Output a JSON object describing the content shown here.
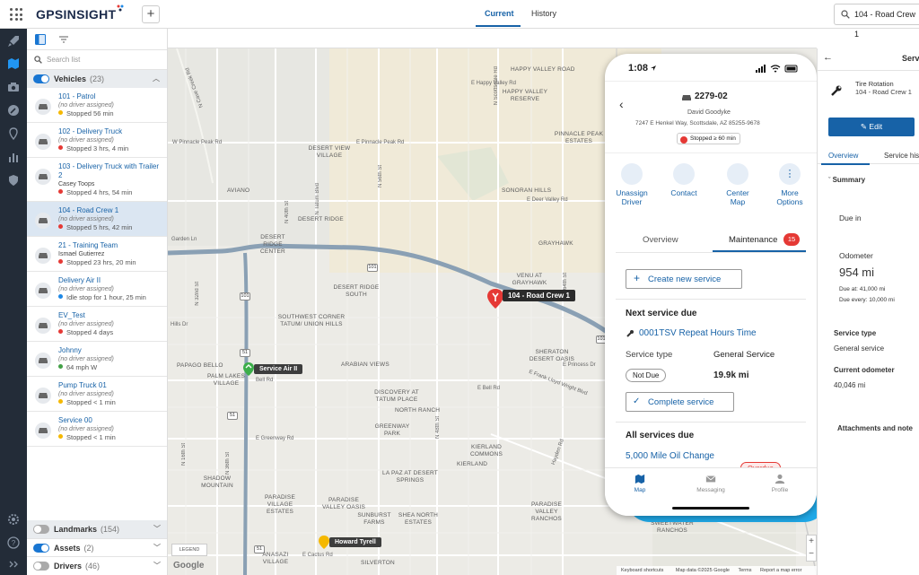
{
  "app": {
    "logo_text": "GPSINSIGHT",
    "tabs": [
      {
        "label": "Current"
      },
      {
        "label": "History"
      }
    ],
    "search_value": "104 - Road Crew 1"
  },
  "panel": {
    "search_placeholder": "Search list",
    "vehicles_header": {
      "label": "Vehicles",
      "count": "(23)"
    },
    "vehicles": [
      {
        "name": "101 - Patrol",
        "driver": "(no driver assigned)",
        "status": "Stopped 56 min",
        "dot": "yellow"
      },
      {
        "name": "102 - Delivery Truck",
        "driver": "(no driver assigned)",
        "status": "Stopped 3 hrs, 4 min",
        "dot": "red"
      },
      {
        "name": "103 - Delivery Truck with Trailer 2",
        "driver": "Casey Toops",
        "status": "Stopped 4 hrs, 54 min",
        "dot": "red"
      },
      {
        "name": "104 - Road Crew 1",
        "driver": "(no driver assigned)",
        "status": "Stopped 5 hrs, 42 min",
        "dot": "red"
      },
      {
        "name": "21 - Training Team",
        "driver": "Ismael Gutierrez",
        "status": "Stopped 23 hrs, 20 min",
        "dot": "red"
      },
      {
        "name": "Delivery Air II",
        "driver": "(no driver assigned)",
        "status": "Idle stop for 1 hour, 25 min",
        "dot": "blue"
      },
      {
        "name": "EV_Test",
        "driver": "(no driver assigned)",
        "status": "Stopped 4 days",
        "dot": "red"
      },
      {
        "name": "Johnny",
        "driver": "(no driver assigned)",
        "status": "64 mph W",
        "dot": "green"
      },
      {
        "name": "Pump Truck 01",
        "driver": "(no driver assigned)",
        "status": "Stopped < 1 min",
        "dot": "yellow"
      },
      {
        "name": "Service 00",
        "driver": "(no driver assigned)",
        "status": "Stopped < 1 min",
        "dot": "yellow"
      }
    ],
    "landmarks_header": {
      "label": "Landmarks",
      "count": "(154)"
    },
    "assets_header": {
      "label": "Assets",
      "count": "(2)"
    },
    "drivers_header": {
      "label": "Drivers",
      "count": "(46)"
    }
  },
  "map": {
    "areas": [
      "HAPPY VALLEY ROAD",
      "HAPPY VALLEY RESERVE",
      "PINNACLE PEAK ESTATES",
      "DESERT VIEW VILLAGE",
      "AVIANO",
      "SONORAN HILLS",
      "DESERT RIDGE",
      "GRAYHAWK",
      "DESERT RIDGE CENTER",
      "VENU AT GRAYHAWK",
      "DESERT RIDGE SOUTH",
      "SOUTHWEST CORNER TATUM/ UNION HILLS",
      "PAPAGO BELLO",
      "ARABIAN VIEWS",
      "SHERATON DESERT OASIS",
      "PALM LAKES VILLAGE",
      "DISCOVERY AT TATUM PLACE",
      "NORTH RANCH",
      "GREENWAY PARK",
      "KIERLAND COMMONS",
      "KIERLAND",
      "LA PAZ AT DESERT SPRINGS",
      "SHADOW MOUNTAIN",
      "PARADISE VILLAGE ESTATES",
      "PARADISE VALLEY OASIS",
      "SUNBURST FARMS",
      "SHEA NORTH ESTATES",
      "ANASAZI VILLAGE",
      "PARADISE VALLEY RANCHOS",
      "SWEETWATER RANCHOS",
      "SILVERTON"
    ],
    "roads": [
      "W Pinnacle Peak Rd",
      "E Pinnacle Peak Rd",
      "E Happy Valley Rd",
      "E Deer Valley Rd",
      "Bell Rd",
      "E Greenway Rd",
      "E Frank Lloyd Wright Blvd",
      "E Princess Dr",
      "E Cactus Rd",
      "N Scottsdale Rd",
      "N Tatum Blvd",
      "N 56th St",
      "N 40th St",
      "N 32nd St",
      "N Cave Creek Rd",
      "Garden Ln",
      "Hills Dr",
      "E Bell Rd",
      "Hayden Rd",
      "N 16th St",
      "N 36th St",
      "N 48th St",
      "N 64th St"
    ],
    "highway_shields": [
      "101",
      "101",
      "51",
      "101",
      "51",
      "51"
    ],
    "pins": [
      {
        "label": "104 - Road Crew 1",
        "color": "#e53935"
      },
      {
        "label": "Service Air II",
        "color": "#3cae4a"
      },
      {
        "label": "Howard Tyrell",
        "color": "#f5b800"
      }
    ],
    "legend": "LEGEND",
    "attribution": [
      "Keyboard shortcuts",
      "Map data ©2025 Google",
      "Terms",
      "Report a map error"
    ],
    "google": "Google"
  },
  "phone": {
    "time": "1:08",
    "vehicle_id": "2279-02",
    "driver": "David Goodyke",
    "address": "7247 E Henkel Way, Scottsdale, AZ 85255-9678",
    "status_badge": "Stopped ≥ 60 min",
    "actions": [
      {
        "label": "Unassign Driver",
        "icon": "unassign-driver-icon"
      },
      {
        "label": "Contact",
        "icon": "contact-card-icon"
      },
      {
        "label": "Center Map",
        "icon": "center-map-icon"
      },
      {
        "label": "More Options",
        "icon": "more-options-icon"
      }
    ],
    "tabs": [
      {
        "label": "Overview"
      },
      {
        "label": "Maintenance",
        "badge": "15"
      }
    ],
    "create_service": "Create new service",
    "next_service_due": "Next service due",
    "service_name": "0001TSV Repeat Hours Time",
    "service_type_label": "Service type",
    "service_type_value": "General Service",
    "not_due": "Not Due",
    "remaining": "19.9k mi",
    "complete_service": "Complete service",
    "all_services_due": "All services due",
    "oil_change": "5,000 Mile Oil Change",
    "overdue": "Overdue",
    "bottom_nav": [
      {
        "label": "Map"
      },
      {
        "label": "Messaging"
      },
      {
        "label": "Profile"
      }
    ]
  },
  "right_panel": {
    "title_fragment": "Servi",
    "item_name": "Tire Rotation",
    "item_vehicle": "104 - Road Crew 1",
    "edit": "Edit",
    "tabs": [
      "Overview",
      "Service his"
    ],
    "summary": "Summary",
    "due_in": "Due in",
    "odometer_label": "Odometer",
    "odometer_value": "954 mi",
    "due_at": "Due at: 41,000 mi",
    "due_every": "Due every: 10,000 mi",
    "service_type_label": "Service type",
    "service_type_value": "General service",
    "current_odometer_label": "Current odometer",
    "current_odometer_value": "40,046 mi",
    "attachments": "Attachments and note"
  },
  "colors": {
    "accent": "#1762a7",
    "nav_bg": "#232c38",
    "phone_accent": "#20a9e8",
    "highway": "#8aa0b4"
  }
}
